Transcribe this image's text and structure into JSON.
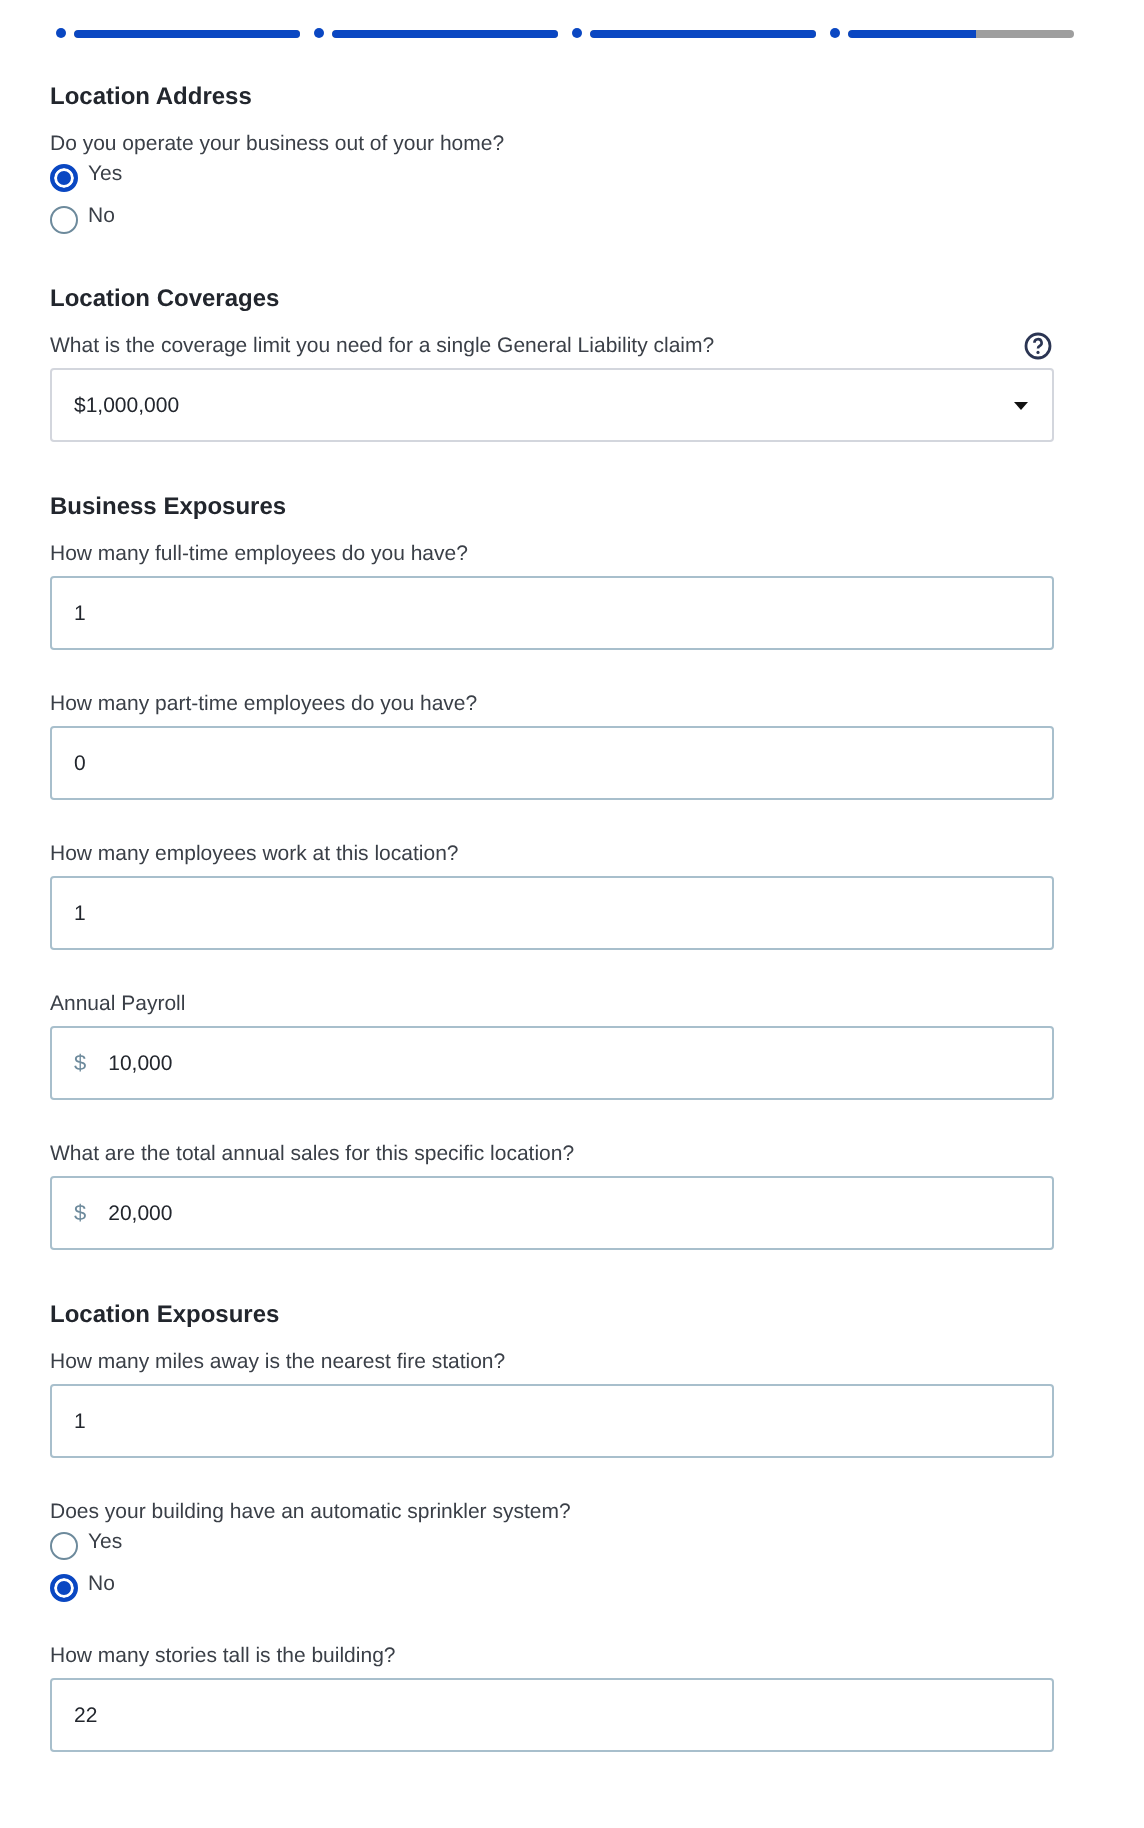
{
  "progress": [
    {
      "level": 1
    },
    {
      "level": 1
    },
    {
      "level": 1
    },
    {
      "level": 0.57
    }
  ],
  "sections": [
    {
      "title": "Location Address",
      "fields": [
        {
          "kind": "radio",
          "label": "Do you operate your business out of your home?",
          "options": [
            {
              "label": "Yes",
              "selected": true
            },
            {
              "label": "No",
              "selected": false
            }
          ]
        }
      ]
    },
    {
      "title": "Location Coverages",
      "fields": [
        {
          "kind": "select",
          "label": "What is the coverage limit you need for a single General Liability claim?",
          "value": "$1,000,000",
          "help": true
        }
      ]
    },
    {
      "title": "Business Exposures",
      "fields": [
        {
          "kind": "text",
          "label": "How many full-time employees do you have?",
          "value": "1"
        },
        {
          "kind": "text",
          "label": "How many part-time employees do you have?",
          "value": "0"
        },
        {
          "kind": "text",
          "label": "How many employees work at this location?",
          "value": "1"
        },
        {
          "kind": "currency",
          "label": "Annual Payroll",
          "prefix": "$",
          "value": "10,000"
        },
        {
          "kind": "currency",
          "label": "What are the total annual sales for this specific location?",
          "prefix": "$",
          "value": "20,000"
        }
      ]
    },
    {
      "title": "Location Exposures",
      "fields": [
        {
          "kind": "text",
          "label": "How many miles away is the nearest fire station?",
          "value": "1"
        },
        {
          "kind": "radio",
          "label": "Does your building have an automatic sprinkler system?",
          "options": [
            {
              "label": "Yes",
              "selected": false
            },
            {
              "label": "No",
              "selected": true
            }
          ]
        },
        {
          "kind": "text",
          "label": "How many stories tall is the building?",
          "value": "22"
        }
      ]
    }
  ]
}
